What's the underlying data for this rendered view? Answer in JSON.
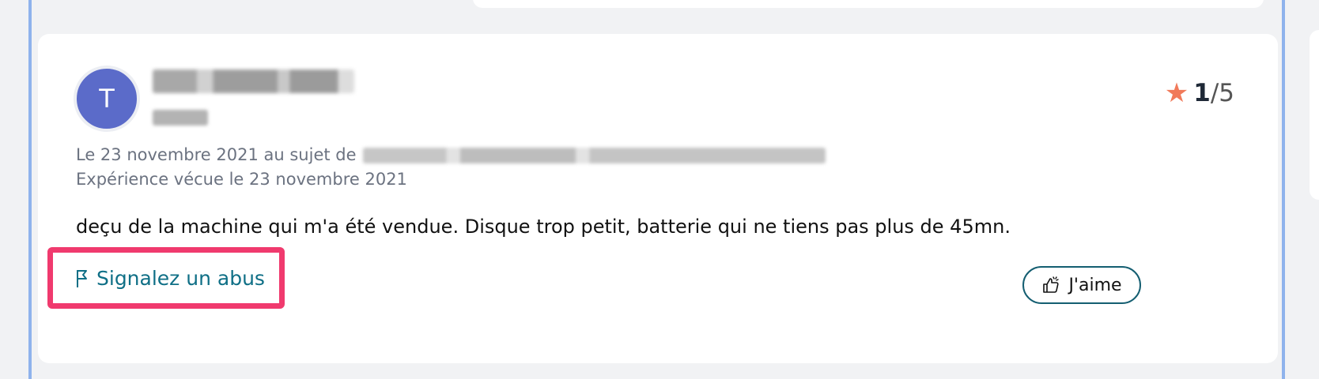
{
  "review": {
    "avatar_initial": "T",
    "rating": {
      "value": "1",
      "total": "/5"
    },
    "date_prefix": "Le 23 novembre 2021 au sujet de",
    "experience": "Expérience vécue le 23 novembre 2021",
    "text": "deçu de la machine qui m'a été vendue. Disque trop petit, batterie qui ne tiens pas plus de 45mn.",
    "report_label": "Signalez un abus",
    "like_label": "J'aime"
  },
  "colors": {
    "accent": "#0f6f86",
    "highlight": "#f03a6e",
    "star": "#f17a5a",
    "avatar": "#5b6bc9"
  },
  "icons": {
    "report": "flag-icon",
    "like": "thumbs-up-icon",
    "rating": "star-icon"
  }
}
